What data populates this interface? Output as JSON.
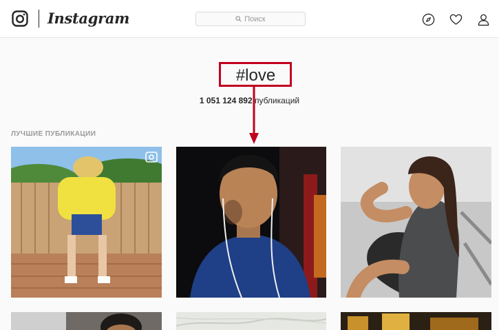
{
  "header": {
    "brand": "Instagram",
    "search_placeholder": "Поиск",
    "icons": [
      "instagram-logo-icon",
      "search-icon",
      "explore-compass-icon",
      "heart-icon",
      "user-icon"
    ]
  },
  "tag": {
    "title": "#love",
    "post_count": "1 051 124 892",
    "post_count_suffix": " публикаций"
  },
  "sections": {
    "top_posts": "ЛУЧШИЕ ПУБЛИКАЦИИ"
  },
  "posts": [
    {
      "name": "post-1",
      "video": true
    },
    {
      "name": "post-2",
      "video": false
    },
    {
      "name": "post-3",
      "video": false
    },
    {
      "name": "post-4",
      "video": false
    },
    {
      "name": "post-5",
      "video": false
    },
    {
      "name": "post-6",
      "video": false
    }
  ],
  "colors": {
    "annotation_red": "#c1001f",
    "text": "#262626",
    "muted": "#999999"
  }
}
